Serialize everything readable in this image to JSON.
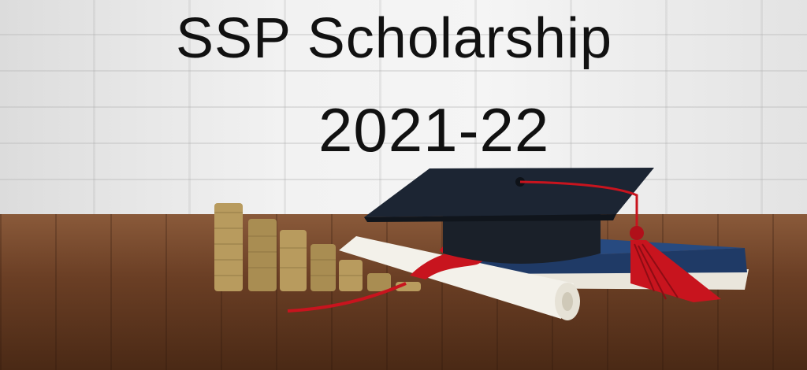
{
  "heading": {
    "title": "SSP Scholarship",
    "year": "2021-22"
  },
  "colors": {
    "text": "#111111",
    "cap": "#1c2533",
    "tassel": "#c8141e",
    "book": "#1f3a66",
    "coin": "#b89b5e",
    "table": "#6b3f25"
  }
}
